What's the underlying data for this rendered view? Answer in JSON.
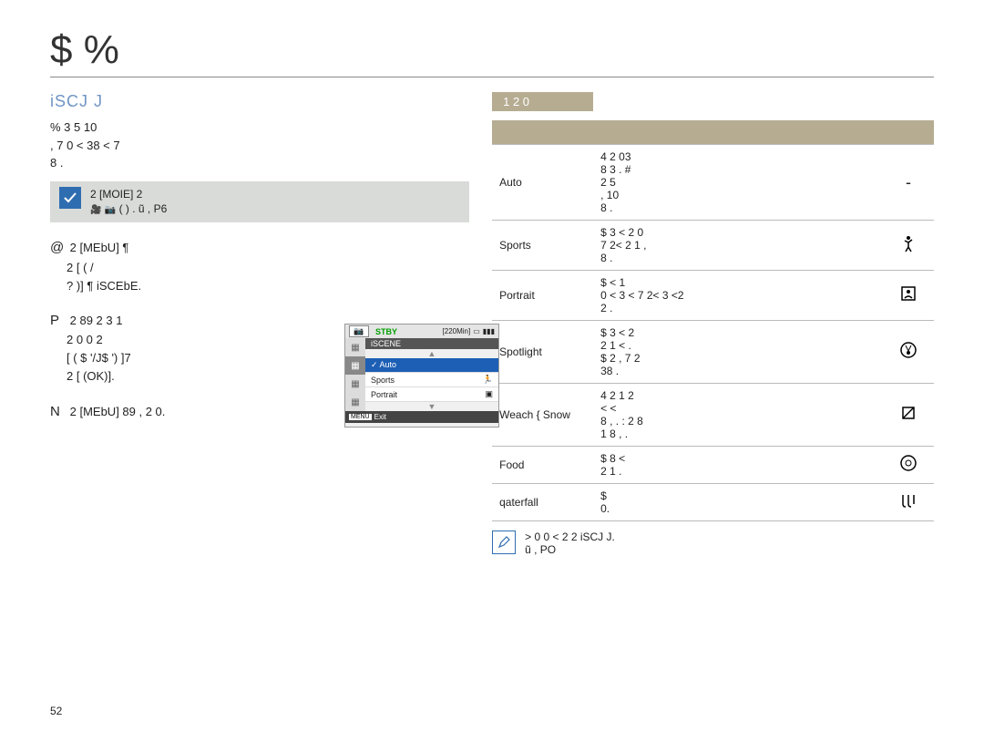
{
  "page": {
    "title": "$    %",
    "subhead": "iSCJ J",
    "number": "52"
  },
  "left": {
    "intro_line1": "%             3 5               10",
    "intro_line2": ",      7 0 <      38       <    7",
    "intro_line3": "8          .",
    "note_line1": "2 [MOIE]     2",
    "note_line2": "(     ) . ũ   , P6",
    "steps": {
      "s1_num": "@",
      "s1_line1": "        2 [MEbU]    ¶",
      "s1_line2": "  2 [       (       /",
      "s1_line3": " ?   )]  ¶  iSCEbE.",
      "s2_num": "P",
      "s2_line1": "2 89       2 3          1",
      "s2_line2": "2     0      0        2",
      "s2_line3": "[      ( $ '/J$ ')         ]7",
      "s2_line4": "   2 [       (OK)].",
      "s3_num": "N",
      "s3_line1": "       2 [MEbU]    89 ,    2      0."
    }
  },
  "lcd": {
    "stby": "STBY",
    "time": "[220Min]",
    "menu_title": "iSCENE",
    "items": {
      "auto": "Auto",
      "sports": "Sports",
      "portrait": "Portrait"
    },
    "footer_label": "MENU",
    "footer_text": "Exit"
  },
  "right": {
    "tab": "1    2     0",
    "rows": [
      {
        "name": "Auto",
        "desc": "4    2        03\n   8    3      . #\n   2    5\n,            10\n      8     .",
        "icon": "-"
      },
      {
        "name": "Sports",
        "desc": "$        3  < 2     0\n   7 2<    2 1 ,\n8  .",
        "icon": "run"
      },
      {
        "name": "Portrait",
        "desc": "$         <    1\n0  < 3   < 7 2<   3 <2\n2 .",
        "icon": "portrait"
      },
      {
        "name": "Spotlight",
        "desc": "$        3  < 2\n2        1  < .\n$ 2   , 7 2\n38 .",
        "icon": "spotlight"
      },
      {
        "name": "Weach { Snow",
        "desc": "4    2      1   2\n <         <\n8   , .   : 2    8\n1   8     , .",
        "icon": "snow"
      },
      {
        "name": "Food",
        "desc": "$       8 <\n2           1  .",
        "icon": "food"
      },
      {
        "name": "qaterfall",
        "desc": "$\n       0.",
        "icon": "waterfall"
      }
    ],
    "note_line1": ">     0     0 <   2       2            iSCJ J.",
    "note_line2": "ũ   , PO"
  }
}
